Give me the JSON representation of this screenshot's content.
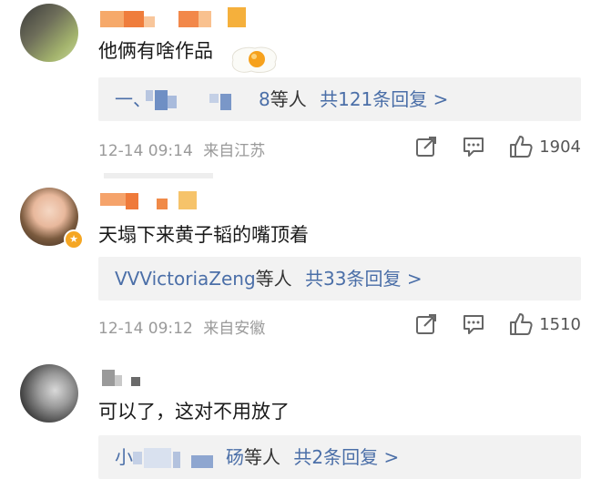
{
  "comments": [
    {
      "text": "他俩有啥作品",
      "reply": {
        "names": "一、",
        "names_tail": "8",
        "etc": "等人",
        "link": "共121条回复 >"
      },
      "meta": {
        "date": "12-14 09:14",
        "location": "来自江苏"
      },
      "likes": "1904"
    },
    {
      "text": "天塌下来黄子韬的嘴顶着",
      "reply": {
        "names": "VVVictoriaZeng",
        "etc": "等人",
        "link": "共33条回复 >"
      },
      "meta": {
        "date": "12-14 09:12",
        "location": "来自安徽"
      },
      "likes": "1510"
    },
    {
      "text": "可以了，这对不用放了",
      "reply": {
        "names": "小",
        "names_tail": "砀",
        "etc": "等人",
        "link": "共2条回复 >"
      }
    }
  ],
  "icons": {
    "share": "share-icon",
    "comment": "comment-icon",
    "like": "thumbs-up-icon",
    "verified": "verified-badge-icon",
    "egg": "fried-egg-icon"
  },
  "colors": {
    "link": "#4b6fa8",
    "meta": "#9a9a9a",
    "reply_bg": "#f2f2f2",
    "username": "#f59a23"
  }
}
